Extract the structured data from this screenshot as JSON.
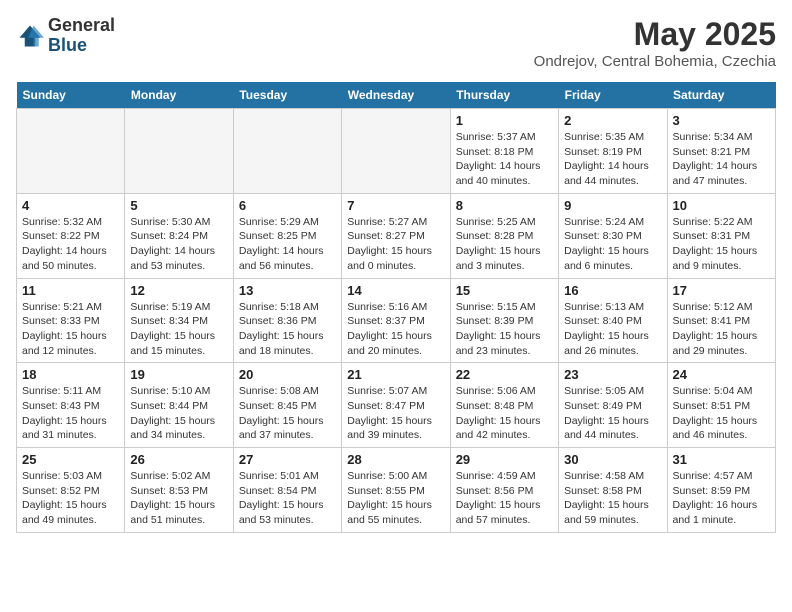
{
  "header": {
    "logo_general": "General",
    "logo_blue": "Blue",
    "month_title": "May 2025",
    "location": "Ondrejov, Central Bohemia, Czechia"
  },
  "weekdays": [
    "Sunday",
    "Monday",
    "Tuesday",
    "Wednesday",
    "Thursday",
    "Friday",
    "Saturday"
  ],
  "weeks": [
    [
      {
        "day": "",
        "info": ""
      },
      {
        "day": "",
        "info": ""
      },
      {
        "day": "",
        "info": ""
      },
      {
        "day": "",
        "info": ""
      },
      {
        "day": "1",
        "info": "Sunrise: 5:37 AM\nSunset: 8:18 PM\nDaylight: 14 hours\nand 40 minutes."
      },
      {
        "day": "2",
        "info": "Sunrise: 5:35 AM\nSunset: 8:19 PM\nDaylight: 14 hours\nand 44 minutes."
      },
      {
        "day": "3",
        "info": "Sunrise: 5:34 AM\nSunset: 8:21 PM\nDaylight: 14 hours\nand 47 minutes."
      }
    ],
    [
      {
        "day": "4",
        "info": "Sunrise: 5:32 AM\nSunset: 8:22 PM\nDaylight: 14 hours\nand 50 minutes."
      },
      {
        "day": "5",
        "info": "Sunrise: 5:30 AM\nSunset: 8:24 PM\nDaylight: 14 hours\nand 53 minutes."
      },
      {
        "day": "6",
        "info": "Sunrise: 5:29 AM\nSunset: 8:25 PM\nDaylight: 14 hours\nand 56 minutes."
      },
      {
        "day": "7",
        "info": "Sunrise: 5:27 AM\nSunset: 8:27 PM\nDaylight: 15 hours\nand 0 minutes."
      },
      {
        "day": "8",
        "info": "Sunrise: 5:25 AM\nSunset: 8:28 PM\nDaylight: 15 hours\nand 3 minutes."
      },
      {
        "day": "9",
        "info": "Sunrise: 5:24 AM\nSunset: 8:30 PM\nDaylight: 15 hours\nand 6 minutes."
      },
      {
        "day": "10",
        "info": "Sunrise: 5:22 AM\nSunset: 8:31 PM\nDaylight: 15 hours\nand 9 minutes."
      }
    ],
    [
      {
        "day": "11",
        "info": "Sunrise: 5:21 AM\nSunset: 8:33 PM\nDaylight: 15 hours\nand 12 minutes."
      },
      {
        "day": "12",
        "info": "Sunrise: 5:19 AM\nSunset: 8:34 PM\nDaylight: 15 hours\nand 15 minutes."
      },
      {
        "day": "13",
        "info": "Sunrise: 5:18 AM\nSunset: 8:36 PM\nDaylight: 15 hours\nand 18 minutes."
      },
      {
        "day": "14",
        "info": "Sunrise: 5:16 AM\nSunset: 8:37 PM\nDaylight: 15 hours\nand 20 minutes."
      },
      {
        "day": "15",
        "info": "Sunrise: 5:15 AM\nSunset: 8:39 PM\nDaylight: 15 hours\nand 23 minutes."
      },
      {
        "day": "16",
        "info": "Sunrise: 5:13 AM\nSunset: 8:40 PM\nDaylight: 15 hours\nand 26 minutes."
      },
      {
        "day": "17",
        "info": "Sunrise: 5:12 AM\nSunset: 8:41 PM\nDaylight: 15 hours\nand 29 minutes."
      }
    ],
    [
      {
        "day": "18",
        "info": "Sunrise: 5:11 AM\nSunset: 8:43 PM\nDaylight: 15 hours\nand 31 minutes."
      },
      {
        "day": "19",
        "info": "Sunrise: 5:10 AM\nSunset: 8:44 PM\nDaylight: 15 hours\nand 34 minutes."
      },
      {
        "day": "20",
        "info": "Sunrise: 5:08 AM\nSunset: 8:45 PM\nDaylight: 15 hours\nand 37 minutes."
      },
      {
        "day": "21",
        "info": "Sunrise: 5:07 AM\nSunset: 8:47 PM\nDaylight: 15 hours\nand 39 minutes."
      },
      {
        "day": "22",
        "info": "Sunrise: 5:06 AM\nSunset: 8:48 PM\nDaylight: 15 hours\nand 42 minutes."
      },
      {
        "day": "23",
        "info": "Sunrise: 5:05 AM\nSunset: 8:49 PM\nDaylight: 15 hours\nand 44 minutes."
      },
      {
        "day": "24",
        "info": "Sunrise: 5:04 AM\nSunset: 8:51 PM\nDaylight: 15 hours\nand 46 minutes."
      }
    ],
    [
      {
        "day": "25",
        "info": "Sunrise: 5:03 AM\nSunset: 8:52 PM\nDaylight: 15 hours\nand 49 minutes."
      },
      {
        "day": "26",
        "info": "Sunrise: 5:02 AM\nSunset: 8:53 PM\nDaylight: 15 hours\nand 51 minutes."
      },
      {
        "day": "27",
        "info": "Sunrise: 5:01 AM\nSunset: 8:54 PM\nDaylight: 15 hours\nand 53 minutes."
      },
      {
        "day": "28",
        "info": "Sunrise: 5:00 AM\nSunset: 8:55 PM\nDaylight: 15 hours\nand 55 minutes."
      },
      {
        "day": "29",
        "info": "Sunrise: 4:59 AM\nSunset: 8:56 PM\nDaylight: 15 hours\nand 57 minutes."
      },
      {
        "day": "30",
        "info": "Sunrise: 4:58 AM\nSunset: 8:58 PM\nDaylight: 15 hours\nand 59 minutes."
      },
      {
        "day": "31",
        "info": "Sunrise: 4:57 AM\nSunset: 8:59 PM\nDaylight: 16 hours\nand 1 minute."
      }
    ]
  ]
}
